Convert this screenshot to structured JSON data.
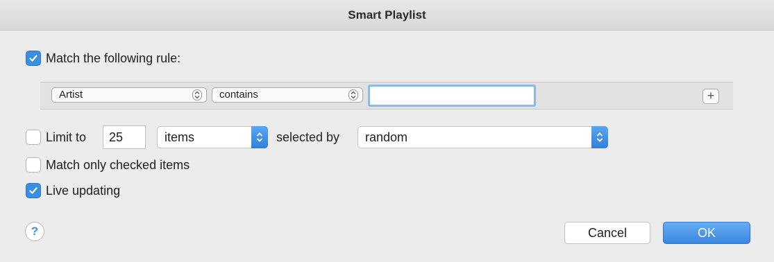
{
  "window": {
    "title": "Smart Playlist"
  },
  "match_rule": {
    "label": "Match the following rule:",
    "checked": true
  },
  "rule": {
    "field": "Artist",
    "operator": "contains",
    "value": ""
  },
  "limit": {
    "label": "Limit to",
    "checked": false,
    "count": "25",
    "unit": "items",
    "selected_by_label": "selected by",
    "selected_by": "random"
  },
  "match_checked": {
    "label": "Match only checked items",
    "checked": false
  },
  "live_updating": {
    "label": "Live updating",
    "checked": true
  },
  "footer": {
    "help_label": "?",
    "cancel_label": "Cancel",
    "ok_label": "OK"
  },
  "colors": {
    "accent": "#3b8fe0",
    "focus_ring": "#8bb9ee"
  }
}
